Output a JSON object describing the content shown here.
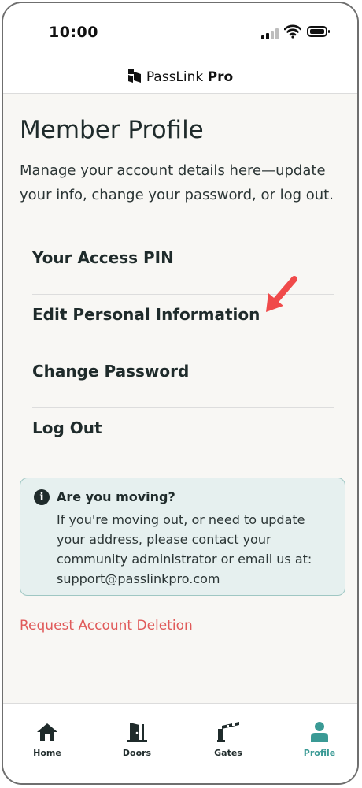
{
  "status_bar": {
    "time": "10:00"
  },
  "brand": {
    "name": "PassLink",
    "suffix": "Pro"
  },
  "page": {
    "title": "Member Profile",
    "description": "Manage your account details here—update your info, change your password, or log out."
  },
  "menu": {
    "items": [
      {
        "label": "Your Access PIN"
      },
      {
        "label": "Edit Personal Information"
      },
      {
        "label": "Change Password"
      },
      {
        "label": "Log Out"
      }
    ]
  },
  "notice": {
    "title": "Are you moving?",
    "body": "If you're moving out, or need to update your address, please contact your community administrator or email us at: support@passlinkpro.com"
  },
  "delete_link": "Request Account Deletion",
  "tabs": [
    {
      "label": "Home",
      "icon": "home-icon"
    },
    {
      "label": "Doors",
      "icon": "door-icon"
    },
    {
      "label": "Gates",
      "icon": "gate-icon"
    },
    {
      "label": "Profile",
      "icon": "person-icon",
      "active": true
    }
  ],
  "colors": {
    "accent": "#3a9a95",
    "danger": "#e05a5a",
    "annotation_arrow": "#f04a4a",
    "text": "#1f2b2b",
    "notice_bg": "#e6f0ef"
  }
}
